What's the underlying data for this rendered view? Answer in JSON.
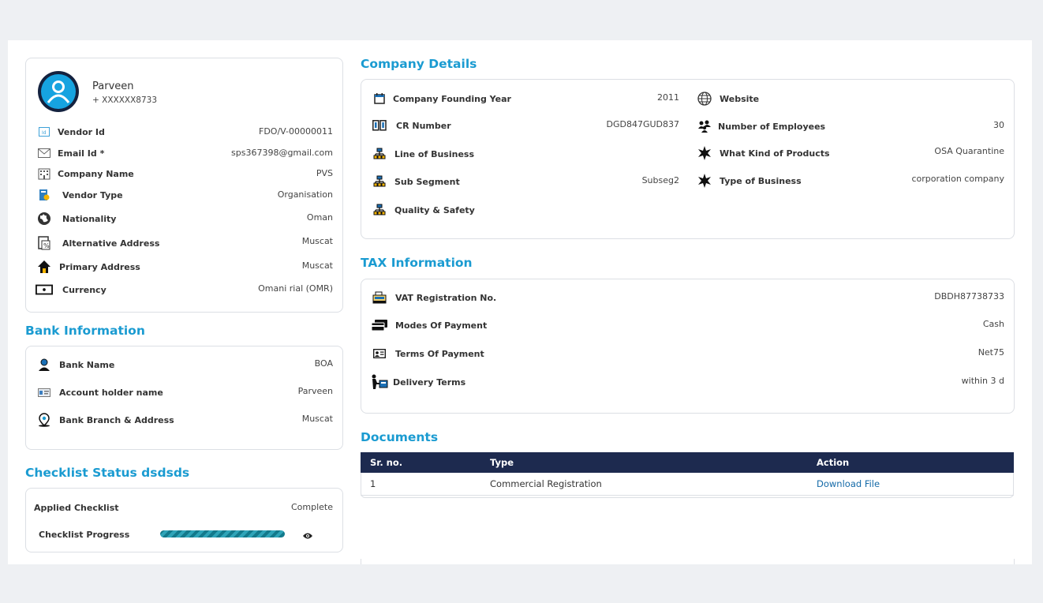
{
  "profile": {
    "name": "Parveen",
    "phone": "+ XXXXXX8733"
  },
  "vendor": [
    {
      "label": "Vendor Id",
      "value": "FDO/V-00000011",
      "icon": "id-card-icon"
    },
    {
      "label": "Email Id *",
      "value": "sps367398@gmail.com",
      "icon": "envelope-icon"
    },
    {
      "label": "Company Name",
      "value": "PVS",
      "icon": "building-icon"
    },
    {
      "label": "Vendor Type",
      "value": "Organisation",
      "icon": "document-badge-icon"
    },
    {
      "label": "Nationality",
      "value": "Oman",
      "icon": "globe-icon"
    },
    {
      "label": "Alternative Address",
      "value": "Muscat",
      "icon": "address-doc-icon"
    },
    {
      "label": "Primary Address",
      "value": "Muscat",
      "icon": "home-icon"
    },
    {
      "label": "Currency",
      "value": "Omani rial (OMR)",
      "icon": "banknote-icon"
    }
  ],
  "bank": {
    "title": "Bank Information",
    "items": [
      {
        "label": "Bank Name",
        "value": "BOA",
        "icon": "banker-icon"
      },
      {
        "label": "Account holder name",
        "value": "Parveen",
        "icon": "card-id-icon"
      },
      {
        "label": "Bank Branch & Address",
        "value": "Muscat",
        "icon": "location-pin-icon"
      }
    ]
  },
  "checklist": {
    "title": "Checklist Status dsdsds",
    "applied_label": "Applied Checklist",
    "applied_value": "Complete",
    "progress_label": "Checklist Progress",
    "progress": 1.0
  },
  "company": {
    "title": "Company Details",
    "left": [
      {
        "label": "Company Founding Year",
        "value": "2011",
        "icon": "calendar-icon"
      },
      {
        "label": "CR Number",
        "value": "DGD847GUD837",
        "icon": "cr-number-icon"
      },
      {
        "label": "Line of Business",
        "value": "",
        "icon": "org-chart-icon"
      },
      {
        "label": "Sub Segment",
        "value": "Subseg2",
        "icon": "org-chart-icon"
      },
      {
        "label": "Quality & Safety",
        "value": "",
        "icon": "org-chart-icon"
      }
    ],
    "right": [
      {
        "label": "Website",
        "value": "",
        "icon": "www-globe-icon"
      },
      {
        "label": "Number of Employees",
        "value": "30",
        "icon": "people-icon"
      },
      {
        "label": "What Kind of Products",
        "value": "OSA Quarantine",
        "icon": "star-burst-icon"
      },
      {
        "label": "Type of Business",
        "value": "corporation company",
        "icon": "star-burst-icon"
      }
    ]
  },
  "tax": {
    "title": "TAX Information",
    "items": [
      {
        "label": "VAT Registration No.",
        "value": "DBDH87738733",
        "icon": "cash-register-icon"
      },
      {
        "label": "Modes Of Payment",
        "value": "Cash",
        "icon": "credit-card-icon"
      },
      {
        "label": "Terms Of Payment",
        "value": "Net75",
        "icon": "contact-card-icon"
      },
      {
        "label": "Delivery Terms",
        "value": "within 3 d",
        "icon": "delivery-icon"
      }
    ]
  },
  "documents": {
    "title": "Documents",
    "headers": [
      "Sr. no.",
      "Type",
      "Action"
    ],
    "rows": [
      {
        "sr": "1",
        "type": "Commercial Registration",
        "action": "Download File"
      }
    ]
  }
}
